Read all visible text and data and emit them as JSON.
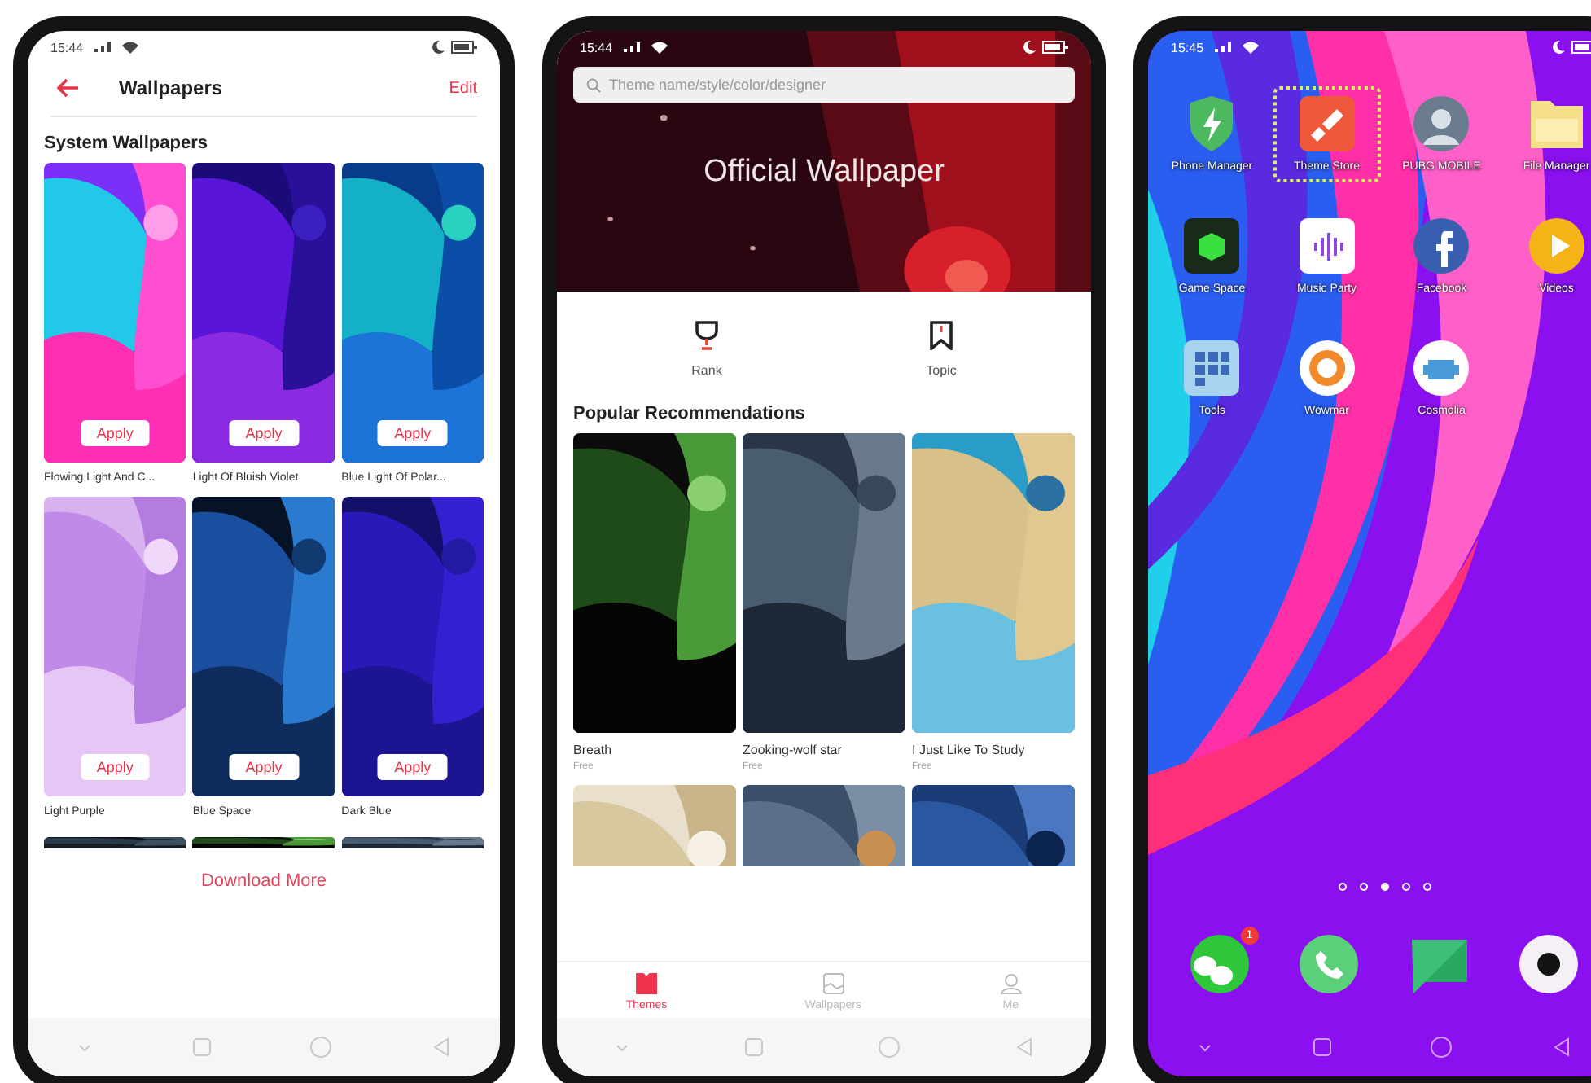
{
  "wallpapers_screen": {
    "status_time": "15:44",
    "title": "Wallpapers",
    "edit": "Edit",
    "section": "System Wallpapers",
    "wallpapers": [
      {
        "name": "Flowing Light And C...",
        "button": "Apply"
      },
      {
        "name": "Light Of Bluish Violet",
        "button": "Apply"
      },
      {
        "name": "Blue Light Of Polar...",
        "button": "Apply"
      },
      {
        "name": "Light Purple",
        "button": "Apply"
      },
      {
        "name": "Blue Space",
        "button": "Apply"
      },
      {
        "name": "Dark Blue",
        "button": "Apply"
      }
    ],
    "download_more": "Download More"
  },
  "theme_store_screen": {
    "status_time": "15:44",
    "search": {
      "placeholder": "Theme name/style/color/designer"
    },
    "banner_title": "Official Wallpaper",
    "shortcuts": [
      {
        "label": "Rank"
      },
      {
        "label": "Topic"
      }
    ],
    "section": "Popular Recommendations",
    "themes": [
      {
        "name": "Breath",
        "price": "Free"
      },
      {
        "name": "Zooking-wolf star",
        "price": "Free"
      },
      {
        "name": "I Just Like To Study",
        "price": "Free"
      }
    ],
    "tabs": [
      {
        "label": "Themes",
        "selected": true
      },
      {
        "label": "Wallpapers",
        "selected": false
      },
      {
        "label": "Me",
        "selected": false
      }
    ]
  },
  "home_screen": {
    "status_time": "15:45",
    "apps": [
      {
        "label": "Phone Manager",
        "highlighted": false
      },
      {
        "label": "Theme Store",
        "highlighted": true
      },
      {
        "label": "PUBG MOBILE",
        "highlighted": false
      },
      {
        "label": "File Manager",
        "highlighted": false
      },
      {
        "label": "Game Space",
        "highlighted": false
      },
      {
        "label": "Music Party",
        "highlighted": false
      },
      {
        "label": "Facebook",
        "highlighted": false
      },
      {
        "label": "Videos",
        "highlighted": false
      },
      {
        "label": "Tools",
        "highlighted": false
      },
      {
        "label": "Wowmar",
        "highlighted": false
      },
      {
        "label": "Cosmolia",
        "highlighted": false
      }
    ],
    "page_dots": [
      {
        "selected": false
      },
      {
        "selected": false
      },
      {
        "selected": true
      },
      {
        "selected": false
      },
      {
        "selected": false
      }
    ],
    "dock": [
      {
        "has_badge": true,
        "badge": "1"
      },
      {
        "has_badge": false
      },
      {
        "has_badge": false
      },
      {
        "has_badge": false
      }
    ]
  }
}
